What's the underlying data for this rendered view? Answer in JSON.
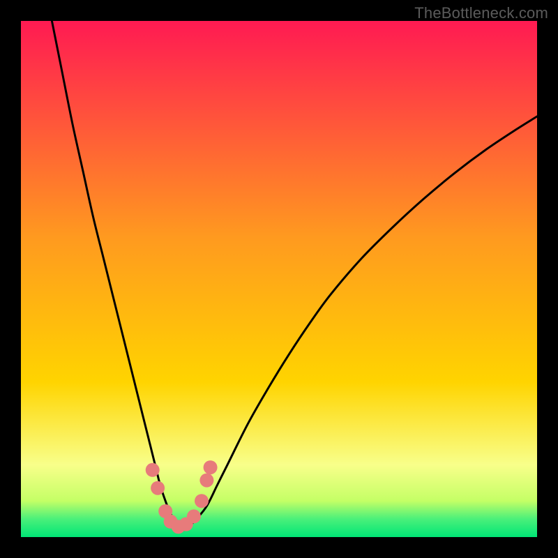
{
  "watermark": "TheBottleneck.com",
  "colors": {
    "frame": "#000000",
    "grad_top": "#ff1a52",
    "grad_mid": "#ffd400",
    "grad_band": "#f8ff8a",
    "grad_green": "#00e676",
    "curve": "#000000",
    "marker": "#e77b7b"
  },
  "chart_data": {
    "type": "line",
    "title": "",
    "xlabel": "",
    "ylabel": "",
    "xlim": [
      0,
      100
    ],
    "ylim": [
      0,
      100
    ],
    "grid": false,
    "legend": null,
    "series": [
      {
        "name": "bottleneck-curve",
        "x": [
          6,
          8,
          10,
          12,
          14,
          16,
          18,
          20,
          22,
          24,
          25,
          26,
          27,
          28,
          29,
          30,
          31,
          32,
          33,
          34,
          36,
          38,
          40,
          44,
          48,
          52,
          56,
          60,
          66,
          72,
          78,
          84,
          90,
          96,
          100
        ],
        "y": [
          100,
          90,
          80,
          71,
          62,
          54,
          46,
          38,
          30,
          22,
          18,
          14,
          10,
          7,
          4.5,
          3,
          2,
          2,
          2.5,
          3.5,
          6,
          10,
          14,
          22,
          29,
          35.5,
          41.5,
          47,
          54,
          60,
          65.5,
          70.5,
          75,
          79,
          81.5
        ]
      }
    ],
    "markers": {
      "name": "sweet-spot-markers",
      "points": [
        {
          "x": 25.5,
          "y": 13
        },
        {
          "x": 26.5,
          "y": 9.5
        },
        {
          "x": 28,
          "y": 5
        },
        {
          "x": 29,
          "y": 3
        },
        {
          "x": 30.5,
          "y": 2
        },
        {
          "x": 32,
          "y": 2.5
        },
        {
          "x": 33.5,
          "y": 4
        },
        {
          "x": 35,
          "y": 7
        },
        {
          "x": 36,
          "y": 11
        },
        {
          "x": 36.7,
          "y": 13.5
        }
      ]
    },
    "gradient_stops": [
      {
        "offset": 0.0,
        "color": "#ff1a52"
      },
      {
        "offset": 0.42,
        "color": "#ff9a1f"
      },
      {
        "offset": 0.7,
        "color": "#ffd400"
      },
      {
        "offset": 0.86,
        "color": "#f8ff8a"
      },
      {
        "offset": 0.93,
        "color": "#c4ff66"
      },
      {
        "offset": 0.965,
        "color": "#4af07a"
      },
      {
        "offset": 1.0,
        "color": "#00e676"
      }
    ]
  }
}
